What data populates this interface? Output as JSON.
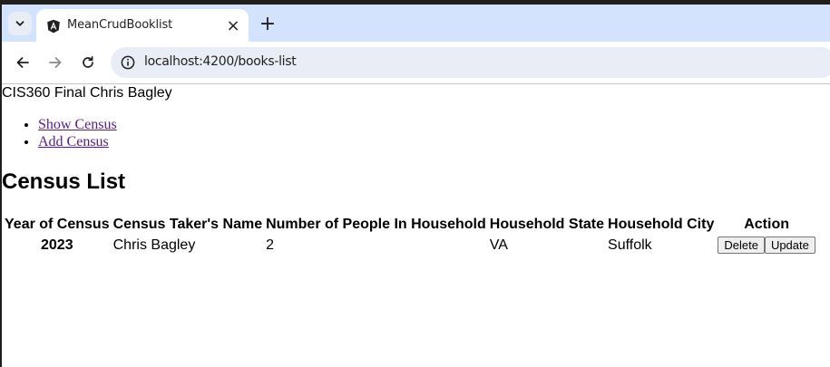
{
  "browser": {
    "tab_title": "MeanCrudBooklist",
    "tab_close": "×",
    "new_tab": "+",
    "url": "localhost:4200/books-list",
    "accent": "#d3e3fd"
  },
  "page": {
    "app_title": "CIS360 Final Chris Bagley",
    "nav": [
      {
        "label": "Show Census"
      },
      {
        "label": "Add Census"
      }
    ],
    "list_heading": "Census List",
    "table": {
      "headers": [
        "Year of Census",
        "Census Taker's Name",
        "Number of People In Household",
        "Household State",
        "Household City",
        "Action"
      ],
      "rows": [
        {
          "year": "2023",
          "name": "Chris Bagley",
          "people": "2",
          "state": "VA",
          "city": "Suffolk",
          "delete_label": "Delete",
          "update_label": "Update"
        }
      ]
    }
  }
}
